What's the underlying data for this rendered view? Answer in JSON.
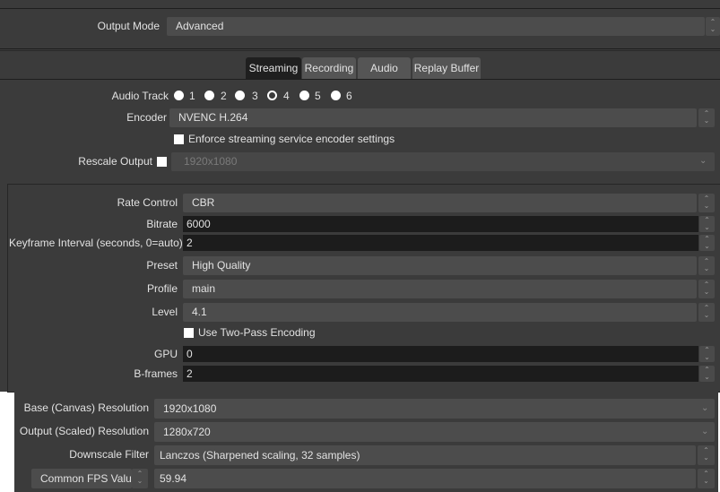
{
  "output_mode": {
    "label": "Output Mode",
    "value": "Advanced"
  },
  "tabs": [
    {
      "label": "Streaming",
      "active": true
    },
    {
      "label": "Recording"
    },
    {
      "label": "Audio"
    },
    {
      "label": "Replay Buffer"
    }
  ],
  "audio_track": {
    "label": "Audio Track",
    "tracks": [
      "1",
      "2",
      "3",
      "4",
      "5",
      "6"
    ],
    "selected": "4"
  },
  "encoder": {
    "label": "Encoder",
    "value": "NVENC H.264"
  },
  "enforce": {
    "label": "Enforce streaming service encoder settings",
    "checked": false
  },
  "rescale": {
    "label": "Rescale Output",
    "checked": false,
    "value": "1920x1080"
  },
  "encoder_settings": {
    "rate_control": {
      "label": "Rate Control",
      "value": "CBR"
    },
    "bitrate": {
      "label": "Bitrate",
      "value": "6000"
    },
    "keyframe": {
      "label": "Keyframe Interval (seconds, 0=auto)",
      "value": "2"
    },
    "preset": {
      "label": "Preset",
      "value": "High Quality"
    },
    "profile": {
      "label": "Profile",
      "value": "main"
    },
    "level": {
      "label": "Level",
      "value": "4.1"
    },
    "two_pass": {
      "label": "Use Two-Pass Encoding",
      "checked": false
    },
    "gpu": {
      "label": "GPU",
      "value": "0"
    },
    "bframes": {
      "label": "B-frames",
      "value": "2"
    }
  },
  "video": {
    "base": {
      "label": "Base (Canvas) Resolution",
      "value": "1920x1080"
    },
    "output": {
      "label": "Output (Scaled) Resolution",
      "value": "1280x720"
    },
    "downscale": {
      "label": "Downscale Filter",
      "value": "Lanczos (Sharpened scaling, 32 samples)"
    },
    "fps": {
      "label": "Common FPS Values",
      "value": "59.94"
    }
  }
}
